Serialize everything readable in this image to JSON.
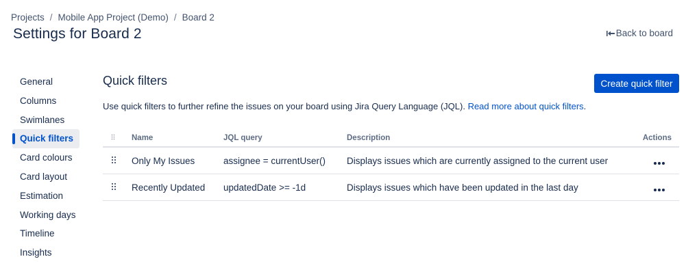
{
  "breadcrumb": {
    "items": [
      "Projects",
      "Mobile App Project (Demo)",
      "Board 2"
    ],
    "separator": "/"
  },
  "page_title": "Settings for Board 2",
  "back_link": {
    "label": "Back to board",
    "icon": "arrow-left-icon"
  },
  "sidebar": {
    "items": [
      {
        "label": "General",
        "active": false
      },
      {
        "label": "Columns",
        "active": false
      },
      {
        "label": "Swimlanes",
        "active": false
      },
      {
        "label": "Quick filters",
        "active": true
      },
      {
        "label": "Card colours",
        "active": false
      },
      {
        "label": "Card layout",
        "active": false
      },
      {
        "label": "Estimation",
        "active": false
      },
      {
        "label": "Working days",
        "active": false
      },
      {
        "label": "Timeline",
        "active": false
      },
      {
        "label": "Insights",
        "active": false
      }
    ]
  },
  "main": {
    "title": "Quick filters",
    "create_button": "Create quick filter",
    "description": "Use quick filters to further refine the issues on your board using Jira Query Language (JQL).",
    "read_more": "Read more about quick filters",
    "read_more_suffix": "."
  },
  "table": {
    "headers": {
      "name": "Name",
      "jql": "JQL query",
      "description": "Description",
      "actions": "Actions"
    },
    "rows": [
      {
        "name": "Only My Issues",
        "jql": "assignee = currentUser()",
        "description": "Displays issues which are currently assigned to the current user"
      },
      {
        "name": "Recently Updated",
        "jql": "updatedDate >= -1d",
        "description": "Displays issues which have been updated in the last day"
      }
    ]
  },
  "colors": {
    "primary": "#0052cc",
    "text": "#172b4d",
    "subtle_text": "#42526e",
    "active_bg": "#ebecf0"
  }
}
